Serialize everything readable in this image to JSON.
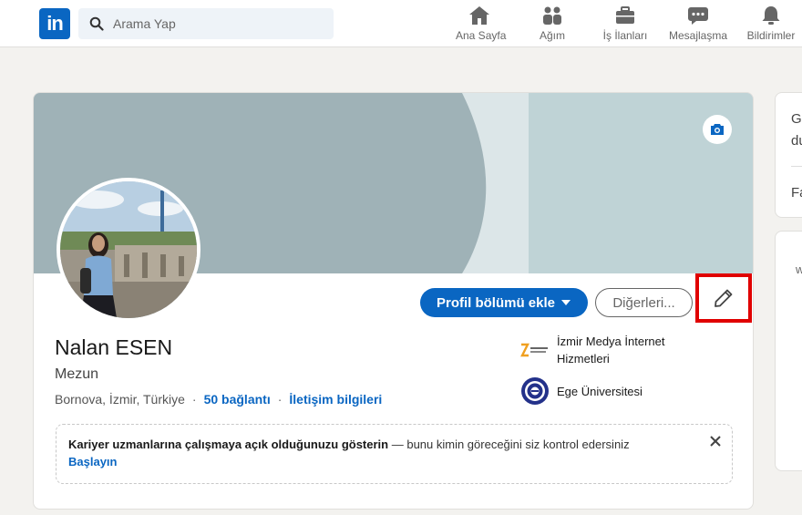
{
  "nav": {
    "search_placeholder": "Arama Yap",
    "items": [
      {
        "label": "Ana Sayfa",
        "icon": "home-icon"
      },
      {
        "label": "Ağım",
        "icon": "network-icon"
      },
      {
        "label": "İş İlanları",
        "icon": "briefcase-icon"
      },
      {
        "label": "Mesajlaşma",
        "icon": "messaging-icon"
      },
      {
        "label": "Bildirimler",
        "icon": "bell-icon"
      }
    ]
  },
  "profile": {
    "name": "Nalan ESEN",
    "headline": "Mezun",
    "location": "Bornova, İzmir, Türkiye",
    "connections": "50 bağlantı",
    "contact_info": "İletişim bilgileri",
    "add_section_label": "Profil bölümü ekle",
    "more_label": "Diğerleri...",
    "experience": [
      {
        "name": "İzmir Medya İnternet Hizmetleri",
        "icon": "izmir-medya-logo"
      },
      {
        "name": "Ege Üniversitesi",
        "icon": "ege-university-logo"
      }
    ]
  },
  "notice": {
    "bold_text": "Kariyer uzmanlarına çalışmaya açık olduğunuzu gösterin",
    "rest_text": " — bunu kimin göreceğini siz kontrol edersiniz",
    "start_label": "Başlayın"
  },
  "sidebar": {
    "line1": "G",
    "line2": "du",
    "line3": "Fa",
    "card2_text": "w"
  },
  "colors": {
    "brand": "#0a66c2",
    "banner": "#bfd3d6",
    "highlight": "#e00000"
  }
}
